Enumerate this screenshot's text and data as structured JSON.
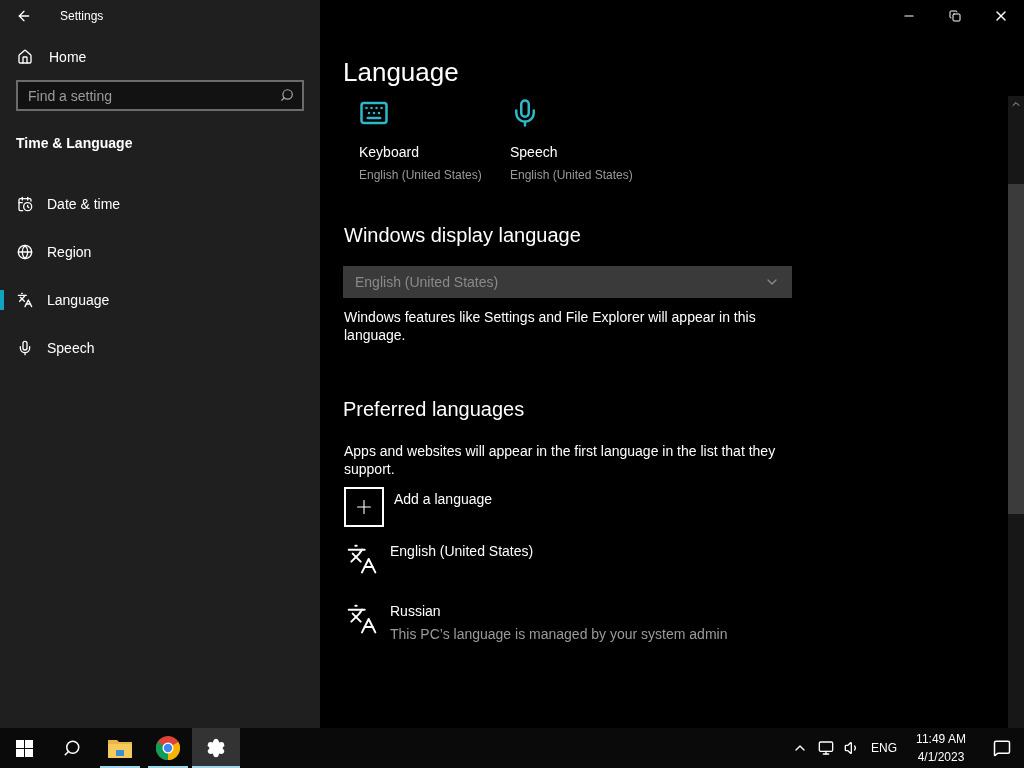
{
  "window": {
    "title": "Settings"
  },
  "sidebar": {
    "home": "Home",
    "search": {
      "placeholder": "Find a setting"
    },
    "section": "Time & Language",
    "items": [
      {
        "label": "Date & time",
        "kind": "calendar",
        "selected": false
      },
      {
        "label": "Region",
        "kind": "globe",
        "selected": false
      },
      {
        "label": "Language",
        "kind": "language",
        "selected": true
      },
      {
        "label": "Speech",
        "kind": "mic",
        "selected": false
      }
    ]
  },
  "page": {
    "title": "Language",
    "tiles": [
      {
        "kind": "keyboard",
        "label": "Keyboard",
        "value": "English (United States)"
      },
      {
        "kind": "mic",
        "label": "Speech",
        "value": "English (United States)"
      }
    ],
    "display_language": {
      "heading": "Windows display language",
      "dropdown": {
        "value": "English (United States)",
        "disabled": true
      },
      "description": "Windows features like Settings and File Explorer will appear in this language."
    },
    "preferred": {
      "heading": "Preferred languages",
      "description": "Apps and websites will appear in the first language in the list that they support.",
      "add": "Add a language",
      "languages": [
        {
          "name": "English (United States)"
        },
        {
          "name": "Russian",
          "note": "This PC’s language is managed by your system admin"
        }
      ]
    }
  },
  "taskbar": {
    "apps": [
      {
        "kind": "start",
        "running": false,
        "active": false
      },
      {
        "kind": "search",
        "running": false,
        "active": false
      },
      {
        "kind": "folder",
        "running": true,
        "active": false
      },
      {
        "kind": "browser",
        "running": true,
        "active": false
      },
      {
        "kind": "settings",
        "running": true,
        "active": true
      }
    ],
    "input_indicator": "ENG",
    "time": "11:49 AM",
    "date": "4/1/2023"
  }
}
